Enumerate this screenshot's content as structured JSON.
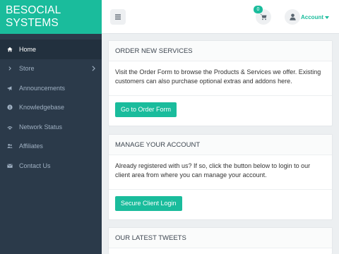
{
  "brand": "BESOCIAL SYSTEMS",
  "sidebar": {
    "items": [
      {
        "label": "Home"
      },
      {
        "label": "Store"
      },
      {
        "label": "Announcements"
      },
      {
        "label": "Knowledgebase"
      },
      {
        "label": "Network Status"
      },
      {
        "label": "Affiliates"
      },
      {
        "label": "Contact Us"
      }
    ]
  },
  "topbar": {
    "cart_count": "0",
    "account_label": "Account"
  },
  "panels": {
    "order": {
      "title": "ORDER NEW SERVICES",
      "text": "Visit the Order Form to browse the Products & Services we offer. Existing customers can also purchase optional extras and addons here.",
      "button": "Go to Order Form"
    },
    "account": {
      "title": "MANAGE YOUR ACCOUNT",
      "text": "Already registered with us? If so, click the button below to login to our client area from where you can manage your account.",
      "button": "Secure Client Login"
    },
    "tweets": {
      "title": "OUR LATEST TWEETS"
    }
  },
  "colors": {
    "accent": "#1abc9c",
    "sidebar_bg": "#2b3a4a"
  },
  "icons": [
    "home-icon",
    "chevron-right-icon",
    "bullhorn-icon",
    "info-circle-icon",
    "signal-icon",
    "users-icon",
    "envelope-icon",
    "bars-icon",
    "cart-icon",
    "user-icon"
  ]
}
